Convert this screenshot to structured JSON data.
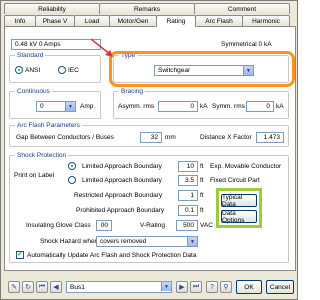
{
  "tabs_row1": [
    "Reliability",
    "Remarks",
    "Comment"
  ],
  "tabs_row2": [
    "Info",
    "Phase V",
    "Load",
    "Motor/Gen",
    "Rating",
    "Arc Flash",
    "Harmonic"
  ],
  "rating_line": "0.48 kV 0 Amps",
  "symmetrical": "Symmetrical 0 kA",
  "standard": {
    "title": "Standard",
    "ansi": "ANSI",
    "iec": "IEC"
  },
  "type": {
    "title": "Type",
    "value": "Switchgear"
  },
  "continuous": {
    "title": "Continuous",
    "value": "0",
    "unit": "Amp"
  },
  "bracing": {
    "title": "Bracing",
    "asymm_label": "Asymm. rms",
    "asymm_value": "0",
    "asymm_unit": "kA",
    "symm_label": "Symm. rms",
    "symm_value": "0",
    "symm_unit": "kA"
  },
  "arcflash": {
    "title": "Arc Flash Parameters",
    "gap_label": "Gap Between Conductors / Buses",
    "gap_value": "32",
    "gap_unit": "mm",
    "dist_label": "Distance X Factor",
    "dist_value": "1.473"
  },
  "shock": {
    "title": "Shock Protection",
    "print_label": "Print on Label",
    "lab1_label": "Limited Approach Boundary",
    "lab1_value": "10",
    "lab1_unit": "ft",
    "lab1_note": "Exp. Movable Conductor",
    "lab2_label": "Limited Approach Boundary",
    "lab2_value": "3.5",
    "lab2_unit": "ft",
    "lab2_note": "Fixed Circuit Part",
    "rab_label": "Restricted Approach Boundary",
    "rab_value": "1",
    "rab_unit": "ft",
    "pab_label": "Prohibited Approach Boundary",
    "pab_value": "0.1",
    "pab_unit": "ft",
    "glove_label": "Insulating Glove Class",
    "glove_value": "00",
    "vrating_label": "V-Rating",
    "vrating_value": "500",
    "vrating_unit": "VAC",
    "hazard_label": "Shock Hazard when",
    "hazard_value": "covers removed",
    "typical_btn": "Typical Data",
    "options_btn": "Data Options",
    "auto_update": "Automatically Update Arc Flash and Shock Protection Data"
  },
  "bottom": {
    "bus": "Bus1",
    "ok": "OK",
    "cancel": "Cancel"
  },
  "colors": {
    "highlight_orange": "#f7941d",
    "highlight_green": "#9ccb3b",
    "arrow_red": "#e3342f"
  }
}
